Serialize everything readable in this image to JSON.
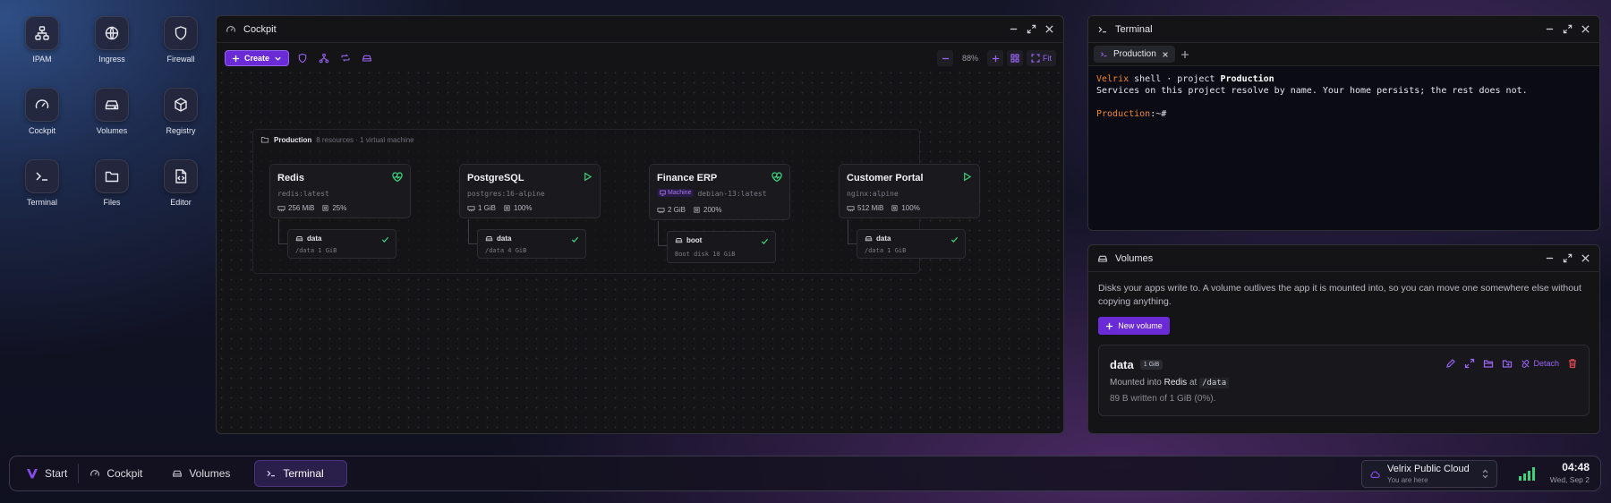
{
  "desktop": {
    "icons": [
      {
        "label": "IPAM",
        "icon": "network-icon"
      },
      {
        "label": "Ingress",
        "icon": "globe-icon"
      },
      {
        "label": "Firewall",
        "icon": "shield-icon"
      },
      {
        "label": "Cockpit",
        "icon": "gauge-icon"
      },
      {
        "label": "Volumes",
        "icon": "disk-icon"
      },
      {
        "label": "Registry",
        "icon": "package-icon"
      },
      {
        "label": "Terminal",
        "icon": "terminal-icon"
      },
      {
        "label": "Files",
        "icon": "folder-icon"
      },
      {
        "label": "Editor",
        "icon": "code-file-icon"
      }
    ]
  },
  "cockpit": {
    "title": "Cockpit",
    "create_label": "Create",
    "zoom": "88%",
    "fit_label": "Fit",
    "group": {
      "name": "Production",
      "summary": "8 resources · 1 virtual machine"
    },
    "services": [
      {
        "name": "Redis",
        "image": "redis:latest",
        "mem": "256 MiB",
        "cpu": "25%",
        "status": "healthy-icon",
        "volume": {
          "name": "data",
          "detail": "/data 1 GiB"
        }
      },
      {
        "name": "PostgreSQL",
        "image": "postgres:16-alpine",
        "mem": "1 GiB",
        "cpu": "100%",
        "status": "play-icon",
        "volume": {
          "name": "data",
          "detail": "/data 4 GiB"
        }
      },
      {
        "name": "Finance ERP",
        "badge": "Machine",
        "image": "debian-13:latest",
        "mem": "2 GiB",
        "cpu": "200%",
        "status": "healthy-icon",
        "volume": {
          "name": "boot",
          "detail": "Boot disk 10 GiB"
        }
      },
      {
        "name": "Customer Portal",
        "image": "nginx:alpine",
        "mem": "512 MiB",
        "cpu": "100%",
        "status": "play-icon",
        "volume": {
          "name": "data",
          "detail": "/data 1 GiB"
        }
      }
    ]
  },
  "terminal": {
    "title": "Terminal",
    "tab_label": "Production",
    "line1": {
      "brand": "Velrix",
      "middle": " shell · project ",
      "project": "Production"
    },
    "line2": "Services on this project resolve by name. Your home persists; the rest does not.",
    "prompt": {
      "host": "Production",
      "suffix": ":~#"
    }
  },
  "volumes": {
    "title": "Volumes",
    "description": "Disks your apps write to. A volume outlives the app it is mounted into, so you can move one somewhere else without copying anything.",
    "new_label": "New volume",
    "card": {
      "name": "data",
      "size": "1 GiB",
      "mounted_prefix": "Mounted into ",
      "mounted_app": "Redis",
      "mounted_mid": " at ",
      "mounted_path": "/data",
      "written": "89 B written of 1 GiB (0%).",
      "detach_label": "Detach"
    }
  },
  "taskbar": {
    "start_label": "Start",
    "items": [
      "Cockpit",
      "Volumes",
      "Terminal"
    ],
    "active": "Terminal",
    "cloud_name": "Velrix Public Cloud",
    "cloud_sub": "You are here",
    "time": "04:48",
    "date": "Wed, Sep 2"
  },
  "colors": {
    "accent": "#6a2bd6",
    "success": "#3ad27a",
    "danger": "#e0454f",
    "prompt_orange": "#f0862e"
  }
}
